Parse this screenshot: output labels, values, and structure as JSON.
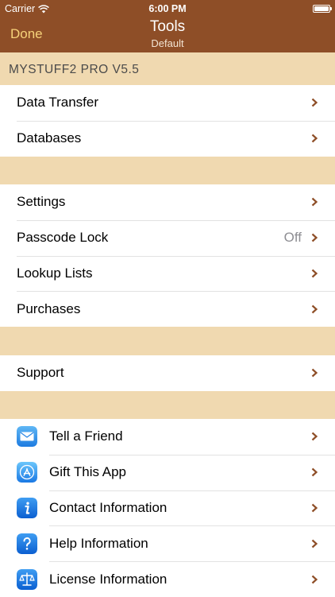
{
  "status": {
    "carrier": "Carrier",
    "time": "6:00 PM"
  },
  "nav": {
    "done": "Done",
    "title": "Tools",
    "subtitle": "Default"
  },
  "header": {
    "app_version": "MYSTUFF2 PRO V5.5"
  },
  "group1": [
    {
      "label": "Data Transfer"
    },
    {
      "label": "Databases"
    }
  ],
  "group2": [
    {
      "label": "Settings"
    },
    {
      "label": "Passcode Lock",
      "value": "Off"
    },
    {
      "label": "Lookup Lists"
    },
    {
      "label": "Purchases"
    }
  ],
  "group3": [
    {
      "label": "Support"
    }
  ],
  "group4": [
    {
      "label": "Tell a Friend",
      "icon": "mail-icon"
    },
    {
      "label": "Gift This App",
      "icon": "app-store-icon"
    },
    {
      "label": "Contact Information",
      "icon": "info-icon"
    },
    {
      "label": "Help Information",
      "icon": "help-icon"
    },
    {
      "label": "License Information",
      "icon": "license-icon"
    }
  ],
  "colors": {
    "nav_bar": "#8e4e27",
    "background": "#f0d9b0",
    "done_text": "#f6d27a",
    "chevron": "#8e4e27"
  }
}
